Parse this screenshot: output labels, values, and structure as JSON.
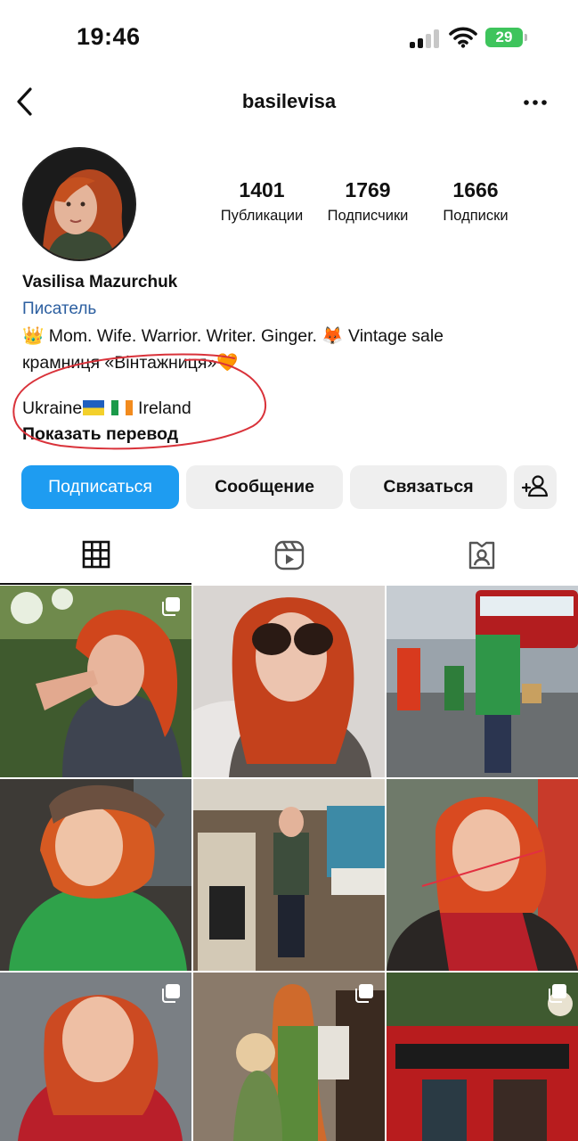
{
  "status_bar": {
    "time": "19:46",
    "battery": "29"
  },
  "nav": {
    "username": "basilevisa"
  },
  "stats": [
    {
      "value": "1401",
      "label": "Публикации"
    },
    {
      "value": "1769",
      "label": "Подписчики"
    },
    {
      "value": "1666",
      "label": "Подписки"
    }
  ],
  "bio": {
    "name": "Vasilisa Mazurchuk",
    "category": "Писатель",
    "crown_emoji": "👑",
    "line1_text": "Mom. Wife. Warrior. Writer. Ginger.",
    "fox_emoji": "🦊",
    "line1_tail": "Vintage sale",
    "line2_text": "крамниця «Вінтажниця»",
    "heart_emoji": "🧡",
    "location_start": "Ukraine",
    "location_end": "Ireland",
    "translate": "Показать перевод"
  },
  "buttons": {
    "follow": "Подписаться",
    "message": "Сообщение",
    "contact": "Связаться"
  },
  "tabs": [
    {
      "name": "grid-icon",
      "active": true
    },
    {
      "name": "reels-icon",
      "active": false
    },
    {
      "name": "tagged-icon",
      "active": false
    }
  ],
  "colors": {
    "accent_blue": "#1e9cf1",
    "category_blue": "#2c5fa0",
    "annotation_red": "#d9323a",
    "button_gray": "#efefef"
  },
  "posts": [
    {
      "multi": true
    },
    {
      "multi": false
    },
    {
      "multi": false
    },
    {
      "multi": false
    },
    {
      "multi": false
    },
    {
      "multi": false
    },
    {
      "multi": true
    },
    {
      "multi": true
    },
    {
      "multi": true
    }
  ]
}
